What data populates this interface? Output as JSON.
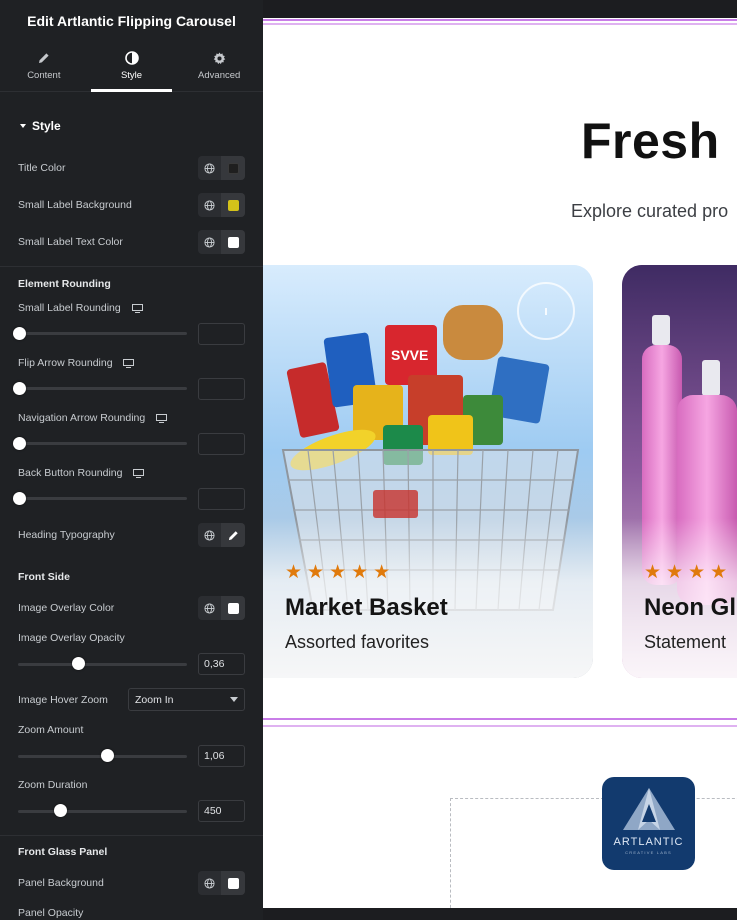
{
  "panel": {
    "header_title": "Edit Artlantic Flipping Carousel",
    "tabs": [
      {
        "label": "Content",
        "icon": "pencil-icon"
      },
      {
        "label": "Style",
        "icon": "contrast-icon",
        "active": true
      },
      {
        "label": "Advanced",
        "icon": "gear-icon"
      }
    ],
    "section_title": "Style",
    "title_color": {
      "label": "Title Color",
      "swatch": "#1f1f1f"
    },
    "small_label_bg": {
      "label": "Small Label Background",
      "swatch": "#d4c21a"
    },
    "small_label_text": {
      "label": "Small Label Text Color",
      "swatch": "#ffffff"
    },
    "rounding_heading": "Element Rounding",
    "small_label_rounding": {
      "label": "Small Label Rounding",
      "value": ""
    },
    "flip_arrow_rounding": {
      "label": "Flip Arrow Rounding",
      "value": ""
    },
    "nav_arrow_rounding": {
      "label": "Navigation Arrow Rounding",
      "value": ""
    },
    "back_button_rounding": {
      "label": "Back Button Rounding",
      "value": ""
    },
    "heading_typography": {
      "label": "Heading Typography"
    },
    "front_side_heading": "Front Side",
    "image_overlay_color": {
      "label": "Image Overlay Color",
      "swatch": "#ffffff"
    },
    "image_overlay_opacity": {
      "label": "Image Overlay Opacity",
      "value": "0,36",
      "fraction": 0.36
    },
    "image_hover_zoom": {
      "label": "Image Hover Zoom",
      "selected": "Zoom In"
    },
    "zoom_amount": {
      "label": "Zoom Amount",
      "value": "1,06",
      "fraction": 0.53
    },
    "zoom_duration": {
      "label": "Zoom Duration",
      "value": "450",
      "fraction": 0.25
    },
    "front_glass_heading": "Front Glass Panel",
    "panel_background": {
      "label": "Panel Background",
      "swatch": "#ffffff"
    },
    "panel_opacity": {
      "label": "Panel Opacity"
    }
  },
  "preview": {
    "title": "Fresh p",
    "subtitle": "Explore curated pro",
    "cards": [
      {
        "stars": "★★★★★",
        "title": "Market Basket",
        "subtitle": "Assorted favorites"
      },
      {
        "stars": "★★★★",
        "title": "Neon Gl",
        "subtitle": "Statement"
      }
    ],
    "logo": {
      "word": "ARTLANTIC",
      "tagline": "CREATIVE LABS"
    }
  },
  "colors": {
    "accent_purple": "#c97ee8",
    "star_orange": "#e07a0c",
    "logo_navy": "#123a6e"
  }
}
